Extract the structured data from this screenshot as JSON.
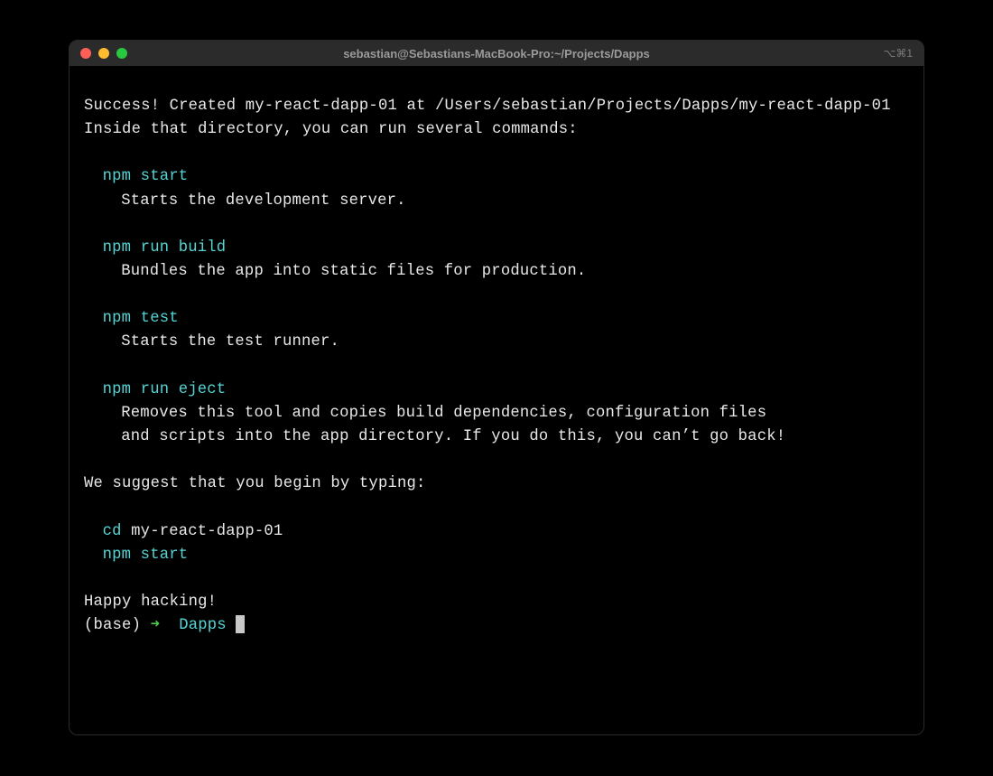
{
  "titlebar": {
    "title": "sebastian@Sebastians-MacBook-Pro:~/Projects/Dapps",
    "shortcut": "⌥⌘1"
  },
  "output": {
    "success_line": "Success! Created my-react-dapp-01 at /Users/sebastian/Projects/Dapps/my-react-dapp-01",
    "inside_line": "Inside that directory, you can run several commands:",
    "cmd1": "npm start",
    "cmd1_desc": "Starts the development server.",
    "cmd2": "npm run build",
    "cmd2_desc": "Bundles the app into static files for production.",
    "cmd3": "npm test",
    "cmd3_desc": "Starts the test runner.",
    "cmd4": "npm run eject",
    "cmd4_desc_a": "Removes this tool and copies build dependencies, configuration files",
    "cmd4_desc_b": "and scripts into the app directory. If you do this, you can’t go back!",
    "suggest": "We suggest that you begin by typing:",
    "type_cd_cmd": "cd",
    "type_cd_arg": " my-react-dapp-01",
    "type_start": "npm start",
    "happy": "Happy hacking!"
  },
  "prompt": {
    "env": "(base) ",
    "arrow": "➜  ",
    "dir": "Dapps"
  }
}
